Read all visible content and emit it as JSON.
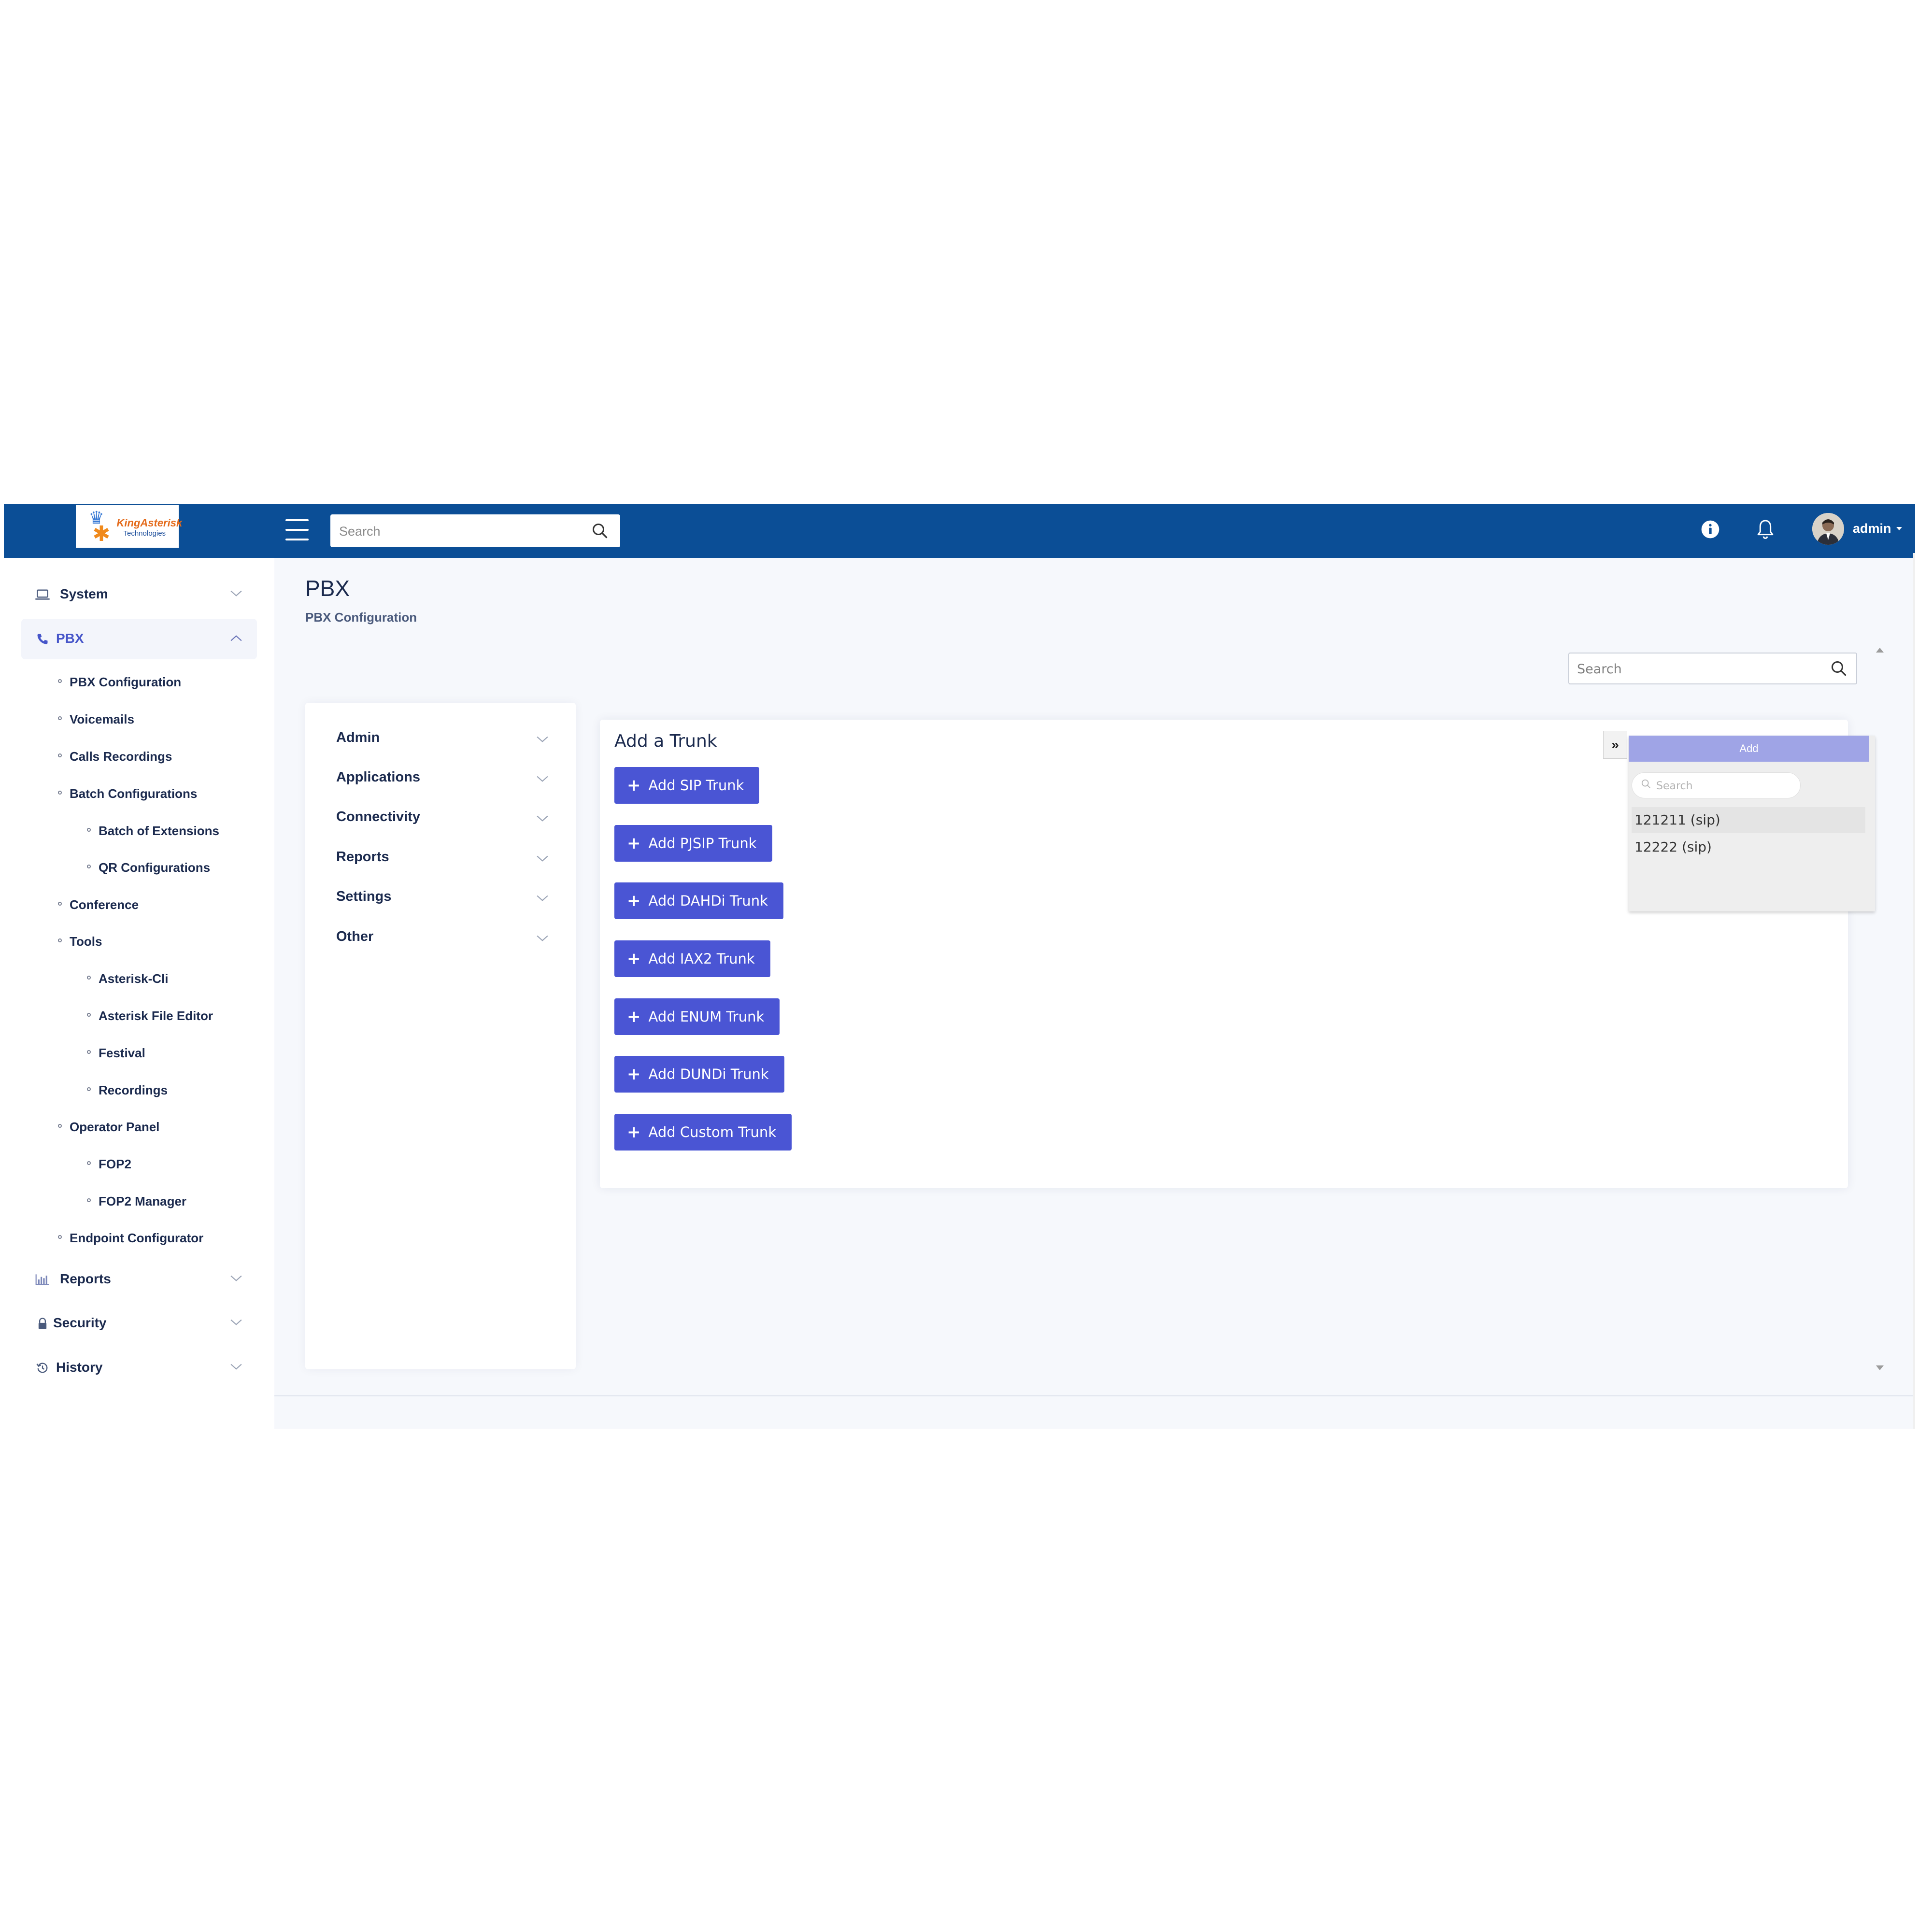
{
  "header": {
    "logo_text": "KingAsterisk",
    "logo_subtext": "Technologies",
    "search_placeholder": "Search",
    "user_name": "admin"
  },
  "sidebar": {
    "main": [
      {
        "label": "System",
        "icon": "laptop-icon"
      },
      {
        "label": "PBX",
        "icon": "phone-icon"
      },
      {
        "label": "Reports",
        "icon": "bar-chart-icon"
      },
      {
        "label": "Security",
        "icon": "lock-icon"
      },
      {
        "label": "History",
        "icon": "history-icon"
      }
    ],
    "pbx_items": [
      {
        "label": "PBX Configuration"
      },
      {
        "label": "Voicemails"
      },
      {
        "label": "Calls Recordings"
      },
      {
        "label": "Batch Configurations"
      },
      {
        "label": "Batch of Extensions"
      },
      {
        "label": "QR Configurations"
      },
      {
        "label": "Conference"
      },
      {
        "label": "Tools"
      },
      {
        "label": "Asterisk-Cli"
      },
      {
        "label": "Asterisk File Editor"
      },
      {
        "label": "Festival"
      },
      {
        "label": "Recordings"
      },
      {
        "label": "Operator Panel"
      },
      {
        "label": "FOP2"
      },
      {
        "label": "FOP2 Manager"
      },
      {
        "label": "Endpoint Configurator"
      }
    ]
  },
  "content": {
    "title": "PBX",
    "subtitle": "PBX Configuration",
    "search_placeholder": "Search",
    "accordion": [
      {
        "label": "Admin"
      },
      {
        "label": "Applications"
      },
      {
        "label": "Connectivity"
      },
      {
        "label": "Reports"
      },
      {
        "label": "Settings"
      },
      {
        "label": "Other"
      }
    ],
    "card": {
      "title": "Add a Trunk",
      "buttons": [
        {
          "label": "Add SIP Trunk"
        },
        {
          "label": "Add PJSIP Trunk"
        },
        {
          "label": "Add DAHDi Trunk"
        },
        {
          "label": "Add IAX2 Trunk"
        },
        {
          "label": "Add ENUM Trunk"
        },
        {
          "label": "Add DUNDi Trunk"
        },
        {
          "label": "Add Custom Trunk"
        }
      ]
    },
    "dual_list": {
      "toggle": "»",
      "header": "Add",
      "search_placeholder": "Search",
      "items": [
        {
          "label": "121211 (sip)"
        },
        {
          "label": "12222 (sip)"
        }
      ]
    }
  },
  "colors": {
    "topbar": "#0b4e96",
    "accent": "#4a55d4",
    "active_nav": "#4655c9",
    "dual_header": "#9fa4e6"
  }
}
